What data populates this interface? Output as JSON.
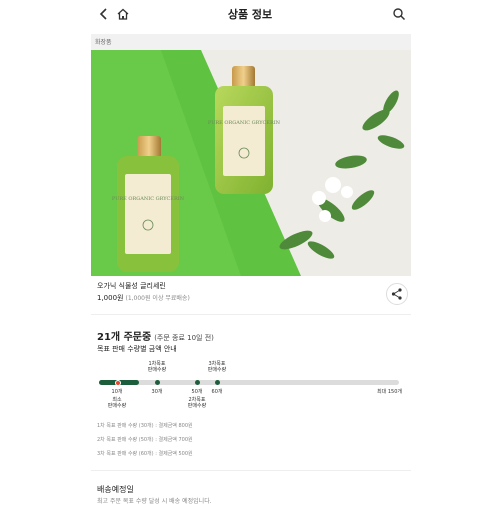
{
  "header": {
    "title": "상품 정보",
    "back_icon": "chevron-left-icon",
    "home_icon": "home-icon",
    "search_icon": "search-icon"
  },
  "category": "화장품",
  "product": {
    "bottle_text": "PURE ORGANIC GRYCERIN",
    "name": "오가닉 식물성 글리세린",
    "price": "1,000원",
    "unit_note": "(1,000원 이상 무료배송)",
    "share_icon": "share-icon"
  },
  "order": {
    "count": "21개 주문중",
    "deadline": "(주문 종료 10일 전)",
    "guide_title": "목표 판매 수량별 금액 안내",
    "progress_value": 21,
    "progress_max": 150,
    "stages": [
      {
        "qty": 10,
        "label_top": "",
        "label_bottom": "최소\n판매수량",
        "tick": "10개"
      },
      {
        "qty": 30,
        "label_top": "1차목표\n판매수량",
        "label_bottom": "",
        "tick": "30개"
      },
      {
        "qty": 50,
        "label_top": "",
        "label_bottom": "2차목표\n판매수량",
        "tick": "50개"
      },
      {
        "qty": 60,
        "label_top": "3차목표\n판매수량",
        "label_bottom": "",
        "tick": "60개"
      }
    ],
    "max_label": "최대 150개"
  },
  "rules": [
    "1차 목표 판매 수량 (30개) : 결제금액 800원",
    "2차 목표 판매 수량 (50개) : 결제금액 700원",
    "3차 목표 판매 수량 (60개) : 결제금액 500원"
  ],
  "delivery": {
    "title": "배송예정일",
    "text": "최고 주문 목표 수량 달성 시 배송 예정입니다."
  },
  "colors": {
    "accent": "#1c5e3b",
    "red_marker": "#e4472d",
    "bg_green": "#5fc241"
  }
}
